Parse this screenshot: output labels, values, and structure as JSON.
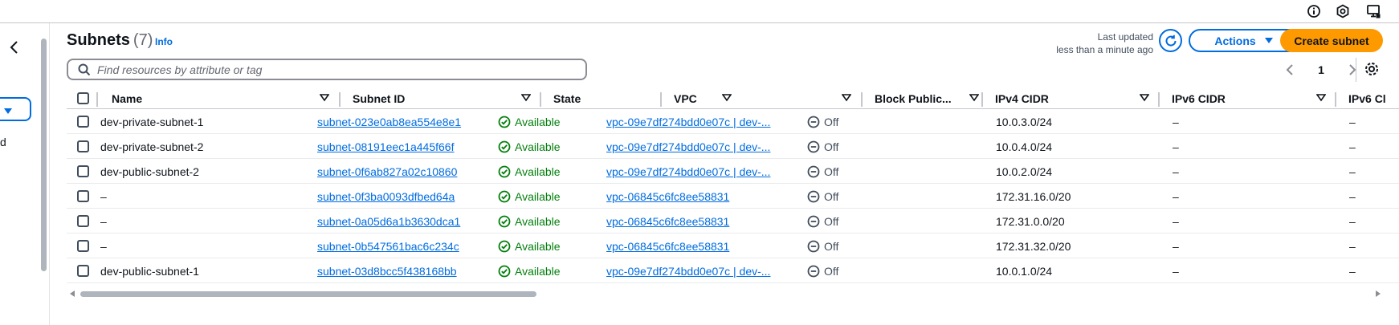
{
  "header": {
    "title": "Subnets",
    "count": "(7)",
    "info": "Info",
    "last_updated_label": "Last updated",
    "last_updated_value": "less than a minute ago",
    "actions_label": "Actions",
    "create_label": "Create subnet"
  },
  "search": {
    "placeholder": "Find resources by attribute or tag"
  },
  "pagination": {
    "page": "1"
  },
  "left_nav": {
    "letter": "d"
  },
  "columns": [
    "Name",
    "Subnet ID",
    "State",
    "VPC",
    "Block Public...",
    "IPv4 CIDR",
    "IPv6 CIDR",
    "IPv6 Cl"
  ],
  "rows": [
    {
      "name": "dev-private-subnet-1",
      "subnet_id": "subnet-023e0ab8ea554e8e1",
      "state": "Available",
      "vpc": "vpc-09e7df274bdd0e07c | dev-...",
      "block_public": "Off",
      "ipv4": "10.0.3.0/24",
      "ipv6": "–",
      "ipv6_cidr2": "–"
    },
    {
      "name": "dev-private-subnet-2",
      "subnet_id": "subnet-08191eec1a445f66f",
      "state": "Available",
      "vpc": "vpc-09e7df274bdd0e07c | dev-...",
      "block_public": "Off",
      "ipv4": "10.0.4.0/24",
      "ipv6": "–",
      "ipv6_cidr2": "–"
    },
    {
      "name": "dev-public-subnet-2",
      "subnet_id": "subnet-0f6ab827a02c10860",
      "state": "Available",
      "vpc": "vpc-09e7df274bdd0e07c | dev-...",
      "block_public": "Off",
      "ipv4": "10.0.2.0/24",
      "ipv6": "–",
      "ipv6_cidr2": "–"
    },
    {
      "name": "–",
      "subnet_id": "subnet-0f3ba0093dfbed64a",
      "state": "Available",
      "vpc": "vpc-06845c6fc8ee58831",
      "block_public": "Off",
      "ipv4": "172.31.16.0/20",
      "ipv6": "–",
      "ipv6_cidr2": "–"
    },
    {
      "name": "–",
      "subnet_id": "subnet-0a05d6a1b3630dca1",
      "state": "Available",
      "vpc": "vpc-06845c6fc8ee58831",
      "block_public": "Off",
      "ipv4": "172.31.0.0/20",
      "ipv6": "–",
      "ipv6_cidr2": "–"
    },
    {
      "name": "–",
      "subnet_id": "subnet-0b547561bac6c234c",
      "state": "Available",
      "vpc": "vpc-06845c6fc8ee58831",
      "block_public": "Off",
      "ipv4": "172.31.32.0/20",
      "ipv6": "–",
      "ipv6_cidr2": "–"
    },
    {
      "name": "dev-public-subnet-1",
      "subnet_id": "subnet-03d8bcc5f438168bb",
      "state": "Available",
      "vpc": "vpc-09e7df274bdd0e07c | dev-...",
      "block_public": "Off",
      "ipv4": "10.0.1.0/24",
      "ipv6": "–",
      "ipv6_cidr2": "–"
    }
  ],
  "icons": {
    "top_right": [
      "info-icon",
      "cloudshell-icon",
      "notifications-icon"
    ],
    "state": "check-circle-icon",
    "block_public": "minus-circle-icon"
  },
  "colors": {
    "accent": "#006ce0",
    "primary_button": "#ff9900",
    "success": "#037f0c",
    "text": "#0f141a"
  }
}
